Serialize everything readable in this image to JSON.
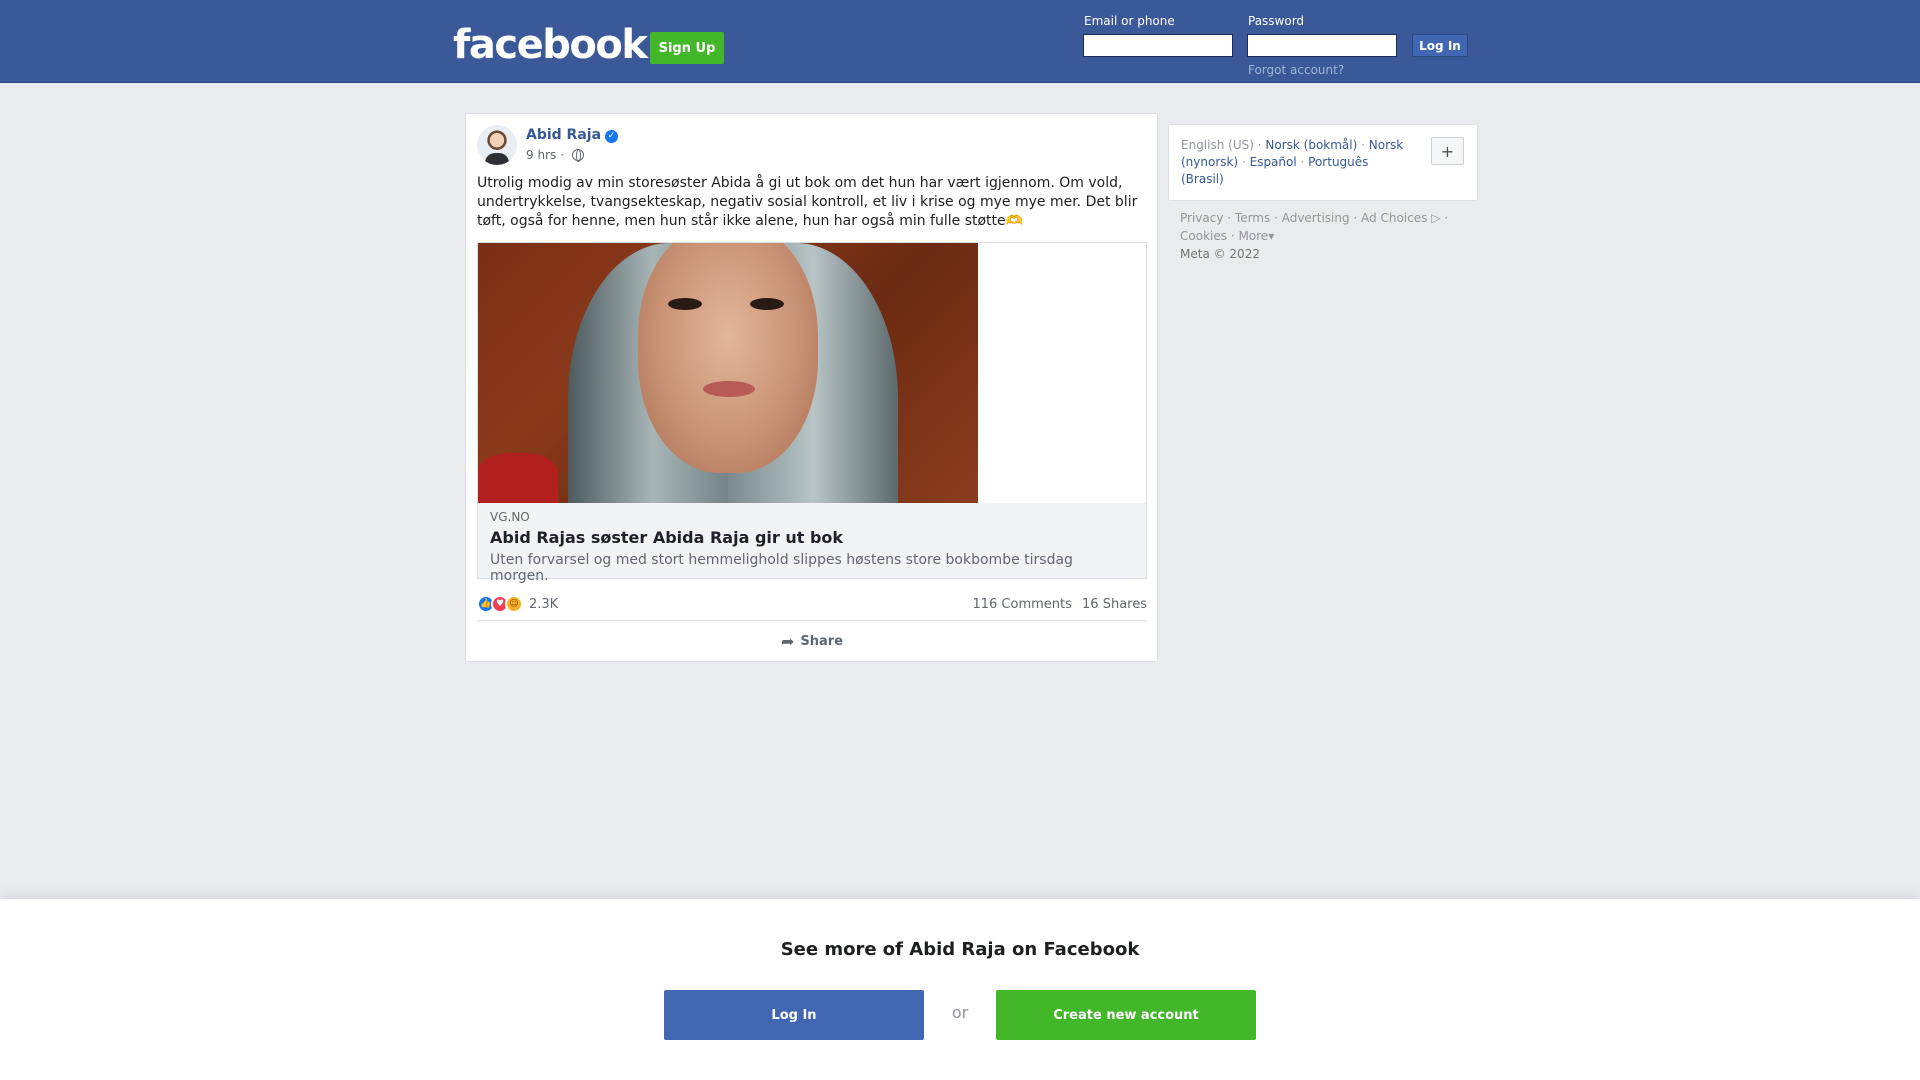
{
  "header": {
    "logo": "facebook",
    "signup_label": "Sign Up",
    "email_label": "Email or phone",
    "password_label": "Password",
    "login_label": "Log In",
    "forgot_label": "Forgot account?"
  },
  "post": {
    "author": "Abid Raja",
    "time": "9 hrs",
    "separator": "·",
    "text": "Utrolig modig av min storesøster Abida å gi ut bok om det hun har vært igjennom. Om vold, undertrykkelse, tvangsekteskap, negativ sosial kontroll, et liv i krise og mye mye mer. Det blir tøft, også for henne, men hun står ikke alene, hun har også min fulle støtte🫶",
    "link": {
      "domain": "VG.NO",
      "title": "Abid Rajas søster Abida Raja gir ut bok",
      "description": "Uten forvarsel og med stort hemmelighold slippes høstens store bokbombe tirsdag morgen."
    },
    "reactions_count": "2.3K",
    "comments": "116 Comments",
    "shares": "16 Shares",
    "share_label": "Share"
  },
  "sidebar": {
    "languages": [
      {
        "label": "English (US)",
        "active": true
      },
      {
        "label": "Norsk (bokmål)"
      },
      {
        "label": "Norsk (nynorsk)"
      },
      {
        "label": "Español"
      },
      {
        "label": "Português (Brasil)"
      }
    ],
    "plus_label": "+",
    "footer_links": [
      "Privacy",
      "Terms",
      "Advertising",
      "Ad Choices",
      "Cookies",
      "More"
    ],
    "copyright": "Meta © 2022"
  },
  "bottom": {
    "title": "See more of Abid Raja on Facebook",
    "login_label": "Log In",
    "or_label": "or",
    "create_label": "Create new account"
  },
  "colors": {
    "brand_blue": "#3b5998",
    "link_blue": "#365899",
    "green": "#42b72a",
    "button_blue": "#4267b2"
  }
}
